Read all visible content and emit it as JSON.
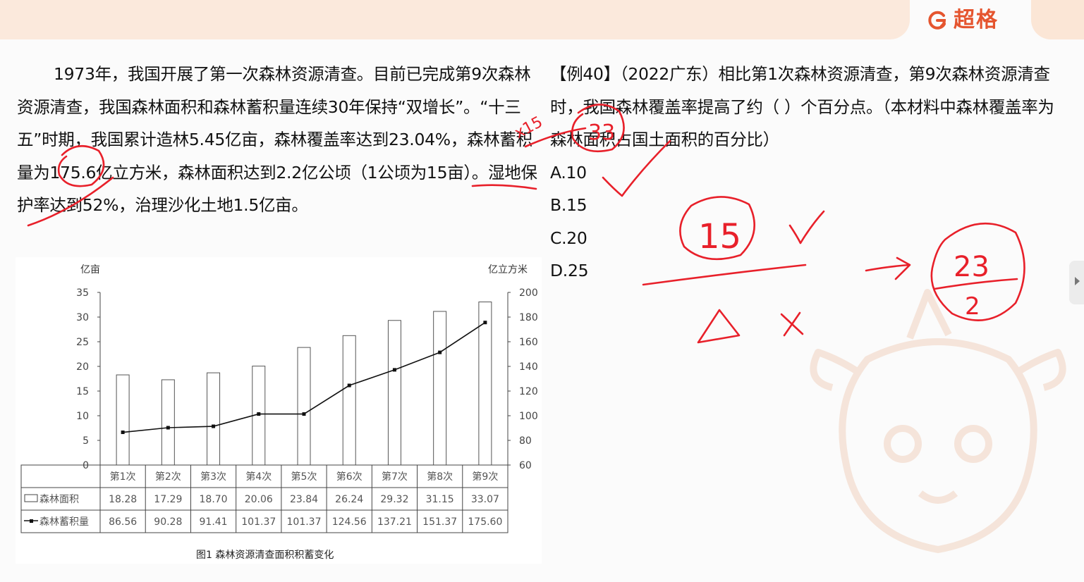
{
  "header": {
    "brand_name": "超格",
    "accent_color": "#e5552f",
    "logo_icon": "brand-c-icon"
  },
  "passage": {
    "lines": [
      "1973年，我国开展了第一次森林资源清查。目前已完成第9",
      "次森林资源清查，我国森林面积和森林蓄积量连续30年保持“双",
      "增长”。“十三五”时期，我国累计造林5.45亿亩，森林覆盖率",
      "达到23.04%，森林蓄积量为175.6亿立方米，森林面积达到2.2亿",
      "公顷（1公顷为15亩）。湿地保护率达到52%，治理沙化土地1.5",
      "亿亩。"
    ]
  },
  "question": {
    "lines": [
      "【例40】（2022广东）相比第1次森林资源清查，第9次森林资",
      "源清查时，我国森林覆盖率提高了约（   ）个百分点。（本材料",
      "中森林覆盖率为森林面积占国土面积的百分比）"
    ],
    "options": [
      "A.10",
      "B.15",
      "C.20",
      "D.25"
    ]
  },
  "figure": {
    "caption": "图1  森林资源清查面积积蓄变化"
  },
  "chart_data": {
    "type": "bar",
    "left_unit": "亿亩",
    "right_unit": "亿立方米",
    "left_ylim": [
      0,
      35
    ],
    "left_ticks": [
      "35",
      "30",
      "25",
      "20",
      "15",
      "10",
      "5",
      "0"
    ],
    "right_ylim": [
      60,
      200
    ],
    "right_ticks": [
      "200",
      "180",
      "160",
      "140",
      "120",
      "100",
      "80",
      "60"
    ],
    "categories": [
      "第1次",
      "第2次",
      "第3次",
      "第4次",
      "第5次",
      "第6次",
      "第7次",
      "第8次",
      "第9次"
    ],
    "series": [
      {
        "name": "森林面积",
        "type": "bar",
        "axis": "left",
        "values": [
          18.28,
          17.29,
          18.7,
          20.06,
          23.84,
          26.24,
          29.32,
          31.15,
          33.07
        ],
        "labels": [
          "18.28",
          "17.29",
          "18.70",
          "20.06",
          "23.84",
          "26.24",
          "29.32",
          "31.15",
          "33.07"
        ]
      },
      {
        "name": "森林蓄积量",
        "type": "line",
        "axis": "right",
        "values": [
          86.56,
          90.28,
          91.41,
          101.37,
          101.37,
          124.56,
          137.21,
          151.37,
          175.6
        ],
        "labels": [
          "86.56",
          "90.28",
          "91.41",
          "101.37",
          "101.37",
          "124.56",
          "137.21",
          "151.37",
          "175.60"
        ]
      }
    ],
    "grid": false,
    "legend": "data-table"
  },
  "annotations": {
    "color": "#e8202a",
    "marks": [
      "x15",
      "33",
      "15",
      "23",
      "2",
      "→",
      "✓",
      "✓",
      "×",
      "△"
    ]
  }
}
